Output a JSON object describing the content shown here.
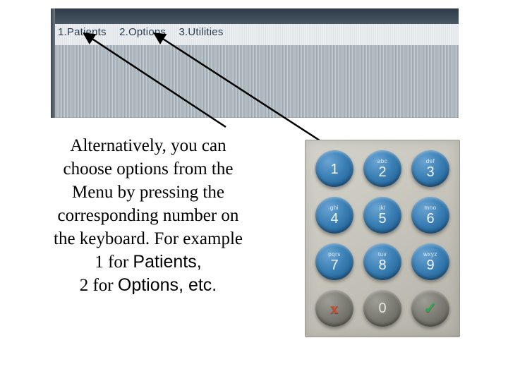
{
  "menu": {
    "item1": "1.Patients",
    "item2": "2.Options",
    "item3": "3.Utilities"
  },
  "body": {
    "l1": "Alternatively, you can",
    "l2": "choose options from the",
    "l3": "Menu by pressing the",
    "l4": "corresponding number on",
    "l5": "the keyboard. For example",
    "l6a": "1 for ",
    "l6b": "Patients",
    "l6c": ",",
    "l7a": "2 for ",
    "l7b": "Options",
    "l7c": ", etc."
  },
  "keys": [
    {
      "sub": "",
      "num": "1"
    },
    {
      "sub": "abc",
      "num": "2"
    },
    {
      "sub": "def",
      "num": "3"
    },
    {
      "sub": "ghi",
      "num": "4"
    },
    {
      "sub": "jkl",
      "num": "5"
    },
    {
      "sub": "mno",
      "num": "6"
    },
    {
      "sub": "pqrs",
      "num": "7"
    },
    {
      "sub": "tuv",
      "num": "8"
    },
    {
      "sub": "wxyz",
      "num": "9"
    }
  ],
  "bottom": {
    "cancel": "x",
    "zero": "0",
    "ok": "✓"
  }
}
